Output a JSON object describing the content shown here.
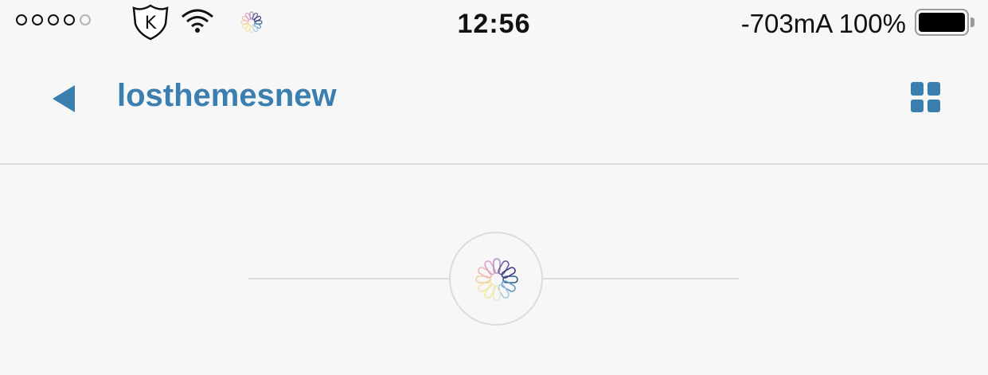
{
  "status_bar": {
    "signal_dots_filled": 4,
    "signal_dots_total": 5,
    "time": "12:56",
    "battery_text": "-703mA 100%",
    "battery_level": 1.0,
    "icons": [
      "shield-k-icon",
      "wifi-icon",
      "activity-spinner-icon",
      "battery-icon"
    ],
    "shield_letter": "K"
  },
  "nav": {
    "title": "losthemesnew",
    "back_icon": "back-triangle-icon",
    "grid_icon": "grid-view-icon"
  },
  "content": {
    "loader_icon": "loading-spinner-icon"
  },
  "colors": {
    "accent": "#3a7fb0",
    "background": "#f7f7f7",
    "divider": "#dcdcdc"
  }
}
